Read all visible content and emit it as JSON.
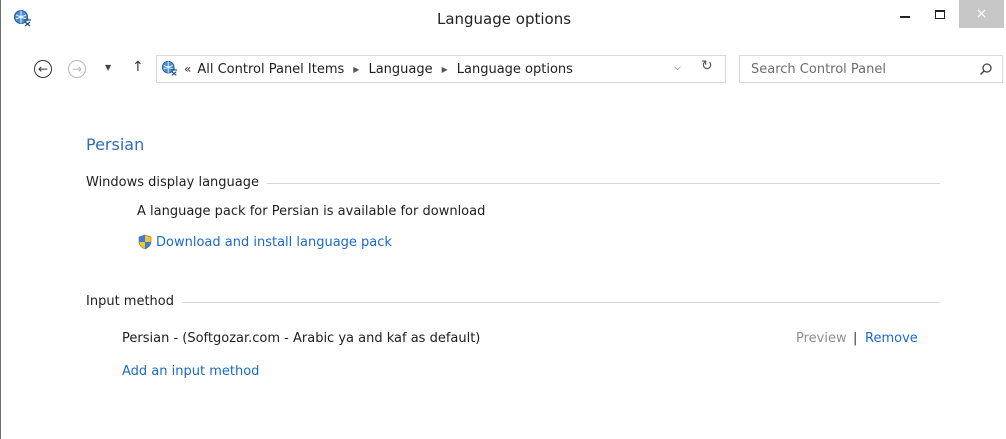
{
  "window": {
    "title": "Language options",
    "close_glyph": "×"
  },
  "nav": {
    "back_icon": "←",
    "forward_icon": "→",
    "recent_icon": "▼",
    "up_icon": "↑",
    "address_chevron": "«",
    "breadcrumbs": [
      "All Control Panel Items",
      "Language",
      "Language options"
    ],
    "crumb_separator": "▶",
    "dropdown_icon": "⌵",
    "refresh_icon": "↻",
    "search_placeholder": "Search Control Panel"
  },
  "content": {
    "language_title": "Persian",
    "display_section_label": "Windows display language",
    "language_pack_text": "A language pack for Persian is available for download",
    "download_link": "Download and install language pack",
    "input_section_label": "Input method",
    "input_method_name": "Persian - (Softgozar.com - Arabic ya and kaf as default)",
    "preview_link": "Preview",
    "separator": "|",
    "remove_link": "Remove",
    "add_input_link": "Add an input method"
  },
  "colors": {
    "link": "#1b6ac9",
    "heading": "#2f6fb7",
    "disabled_link": "#8e8e8e",
    "close_button": "#c7c7c7"
  },
  "icons": {
    "app": "language-globe-icon",
    "shield": "uac-shield-icon",
    "search": "search-icon"
  }
}
